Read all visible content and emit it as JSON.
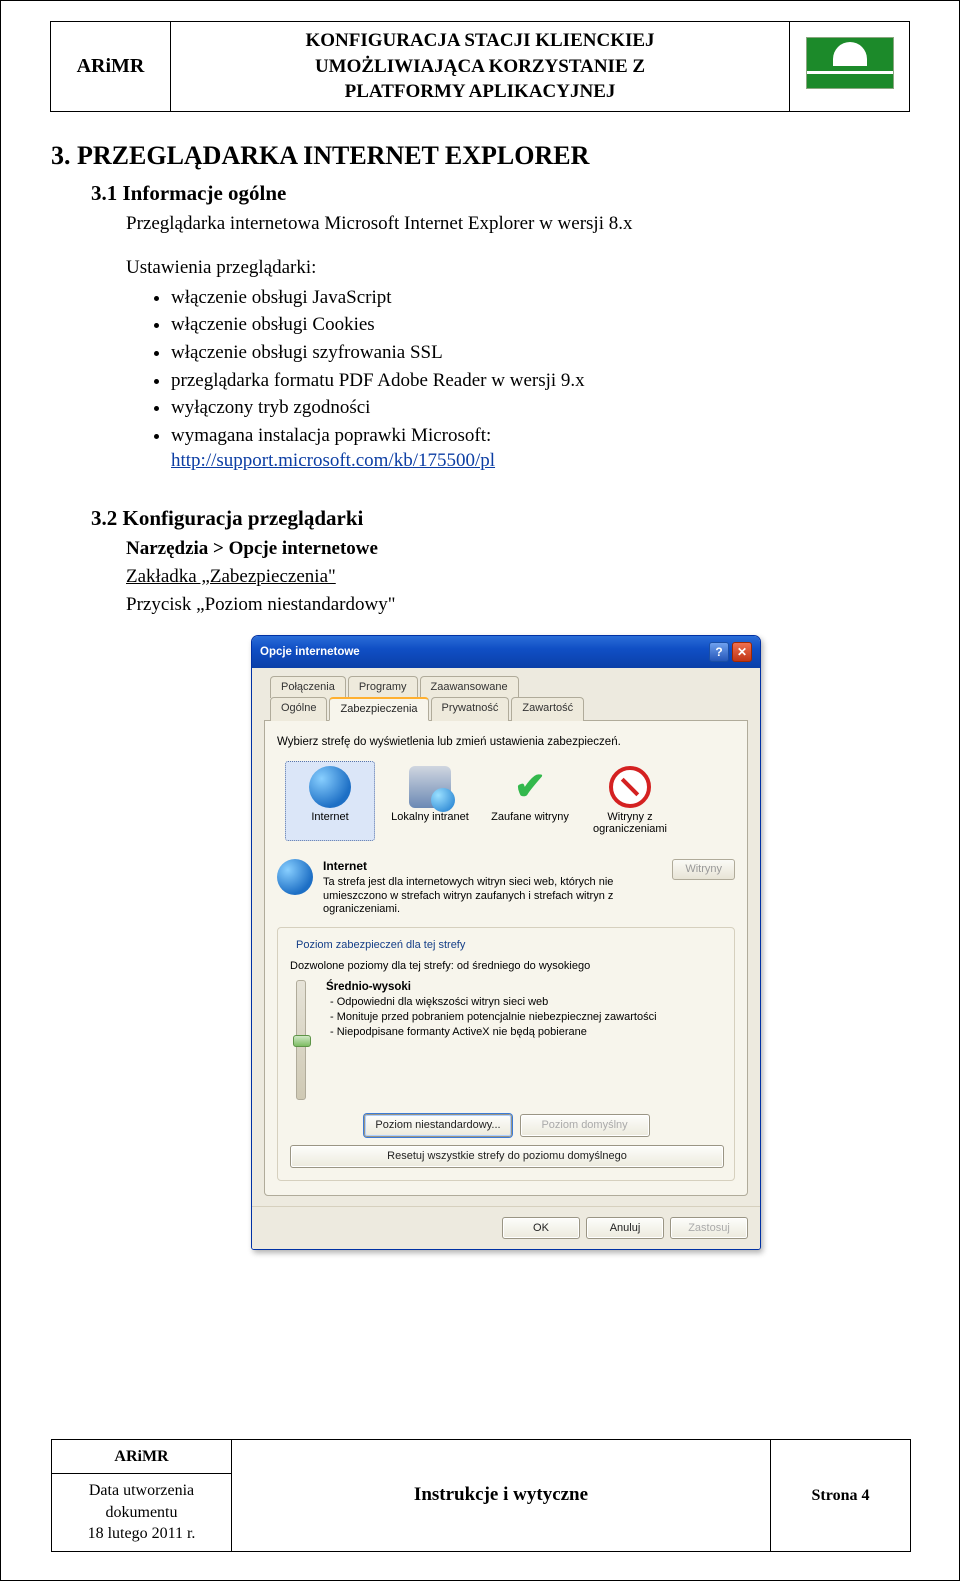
{
  "header": {
    "org": "ARiMR",
    "title_line1": "KONFIGURACJA STACJI KLIENCKIEJ",
    "title_line2": "UMOŻLIWIAJĄCA KORZYSTANIE Z",
    "title_line3": "PLATFORMY APLIKACYJNEJ",
    "logo_brand": "ARiMR"
  },
  "section3": {
    "heading": "3.   PRZEGLĄDARKA INTERNET EXPLORER",
    "sub_3_1": "3.1    Informacje ogólne",
    "intro": "Przeglądarka internetowa Microsoft Internet Explorer w wersji 8.x",
    "settings_label": "Ustawienia przeglądarki:",
    "bullets": [
      "włączenie obsługi JavaScript",
      "włączenie obsługi Cookies",
      "włączenie obsługi szyfrowania SSL",
      "przeglądarka formatu PDF Adobe Reader w wersji 9.x",
      "wyłączony tryb zgodności"
    ],
    "bullet_link_prefix": "wymagana instalacja poprawki Microsoft:",
    "bullet_link_text": "http://support.microsoft.com/kb/175500/pl",
    "sub_3_2": "3.2    Konfiguracja przeglądarki",
    "nav_path": "Narzędzia > Opcje internetowe",
    "tab_desc": "Zakładka „Zabezpieczenia\"",
    "button_desc": "Przycisk „Poziom niestandardowy\""
  },
  "dialog": {
    "title": "Opcje internetowe",
    "tabs_row1": [
      "Połączenia",
      "Programy",
      "Zaawansowane"
    ],
    "tabs_row2": [
      "Ogólne",
      "Zabezpieczenia",
      "Prywatność",
      "Zawartość"
    ],
    "active_tab": "Zabezpieczenia",
    "prompt": "Wybierz strefę do wyświetlenia lub zmień ustawienia zabezpieczeń.",
    "zones": [
      {
        "key": "internet",
        "label": "Internet"
      },
      {
        "key": "intranet",
        "label": "Lokalny intranet"
      },
      {
        "key": "trusted",
        "label": "Zaufane witryny"
      },
      {
        "key": "restricted",
        "label": "Witryny z ograniczeniami"
      }
    ],
    "zone_detail": {
      "name": "Internet",
      "desc": "Ta strefa jest dla internetowych witryn sieci web, których nie umieszczono w strefach witryn zaufanych i strefach witryn z ograniczeniami.",
      "sites_btn": "Witryny"
    },
    "level_group": "Poziom zabezpieczeń dla tej strefy",
    "level_allowed": "Dozwolone poziomy dla tej strefy: od średniego do wysokiego",
    "level_name": "Średnio-wysoki",
    "level_lines": [
      "- Odpowiedni dla większości witryn sieci web",
      "- Monituje przed pobraniem potencjalnie niebezpiecznej zawartości",
      "- Niepodpisane formanty ActiveX nie będą pobierane"
    ],
    "btn_custom": "Poziom niestandardowy...",
    "btn_default": "Poziom domyślny",
    "btn_reset": "Resetuj wszystkie strefy do poziomu domyślnego",
    "btn_ok": "OK",
    "btn_cancel": "Anuluj",
    "btn_apply": "Zastosuj"
  },
  "footer": {
    "org": "ARiMR",
    "date_label": "Data utworzenia dokumentu",
    "date": "18 lutego 2011 r.",
    "center": "Instrukcje i wytyczne",
    "page": "Strona 4"
  }
}
